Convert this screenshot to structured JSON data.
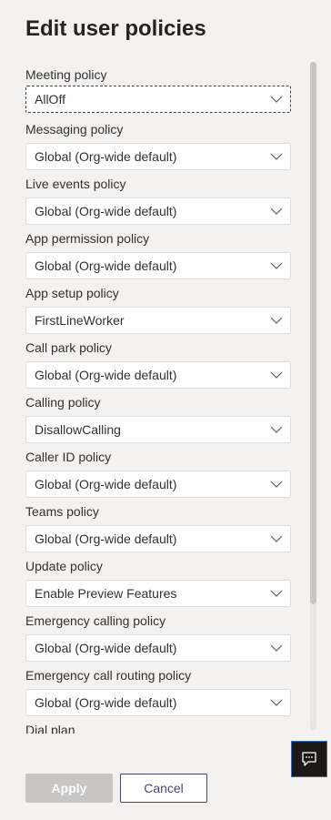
{
  "panel": {
    "title": "Edit user policies"
  },
  "fields": [
    {
      "label": "Meeting policy",
      "value": "AllOff"
    },
    {
      "label": "Messaging policy",
      "value": "Global (Org-wide default)"
    },
    {
      "label": "Live events policy",
      "value": "Global (Org-wide default)"
    },
    {
      "label": "App permission policy",
      "value": "Global (Org-wide default)"
    },
    {
      "label": "App setup policy",
      "value": "FirstLineWorker"
    },
    {
      "label": "Call park policy",
      "value": "Global (Org-wide default)"
    },
    {
      "label": "Calling policy",
      "value": "DisallowCalling"
    },
    {
      "label": "Caller ID policy",
      "value": "Global (Org-wide default)"
    },
    {
      "label": "Teams policy",
      "value": "Global (Org-wide default)"
    },
    {
      "label": "Update policy",
      "value": "Enable Preview Features"
    },
    {
      "label": "Emergency calling policy",
      "value": "Global (Org-wide default)"
    },
    {
      "label": "Emergency call routing policy",
      "value": "Global (Org-wide default)"
    },
    {
      "label": "Dial plan"
    }
  ],
  "footer": {
    "apply_label": "Apply",
    "cancel_label": "Cancel"
  },
  "icons": {
    "dropdown": "chevron-down-icon",
    "feedback": "feedback-icon"
  },
  "colors": {
    "background": "#f3f2f1",
    "accent": "#464775",
    "disabled_button": "#c8c6c4"
  }
}
